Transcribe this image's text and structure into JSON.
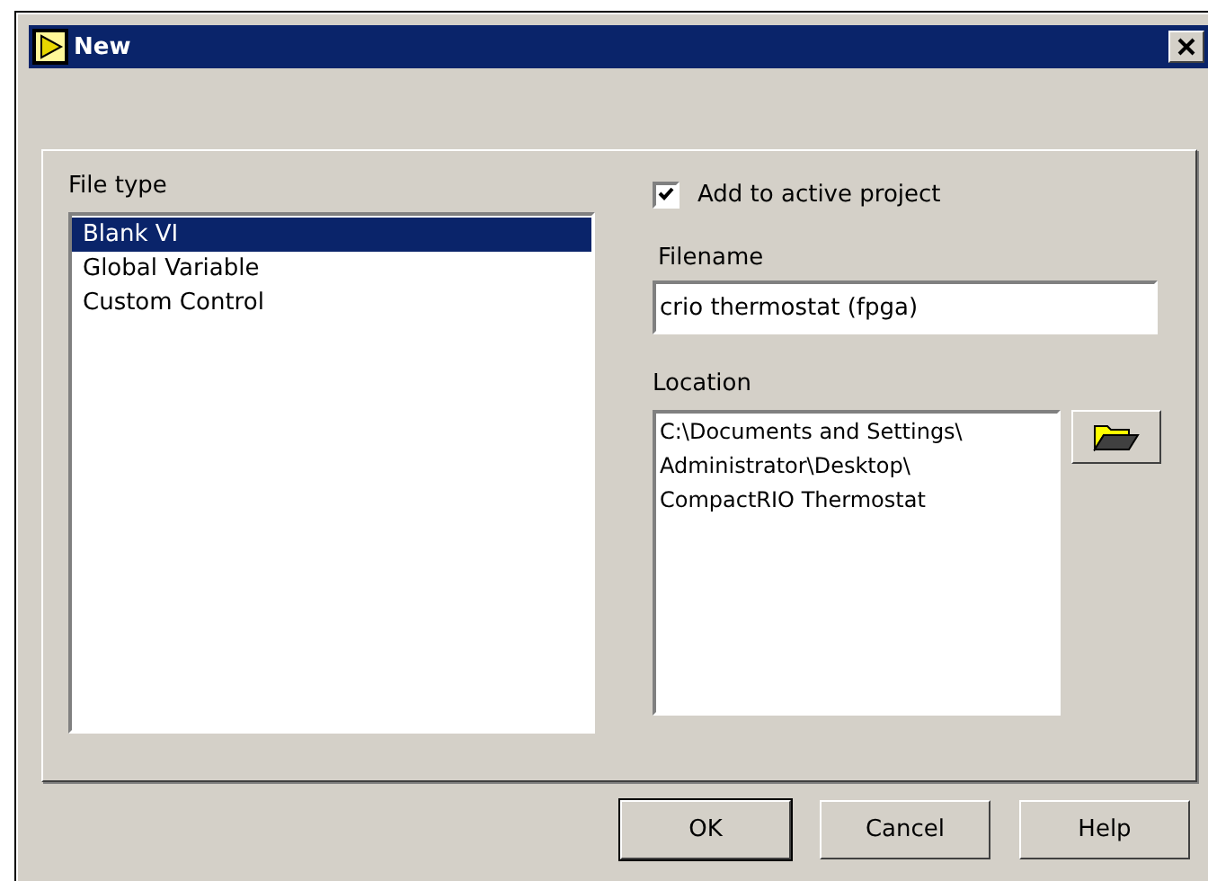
{
  "window": {
    "title": "New"
  },
  "file_type": {
    "label": "File type",
    "items": [
      {
        "label": "Blank VI",
        "selected": true
      },
      {
        "label": "Global Variable",
        "selected": false
      },
      {
        "label": "Custom Control",
        "selected": false
      }
    ]
  },
  "add_to_project": {
    "label": "Add to active project",
    "checked": true
  },
  "filename": {
    "label": "Filename",
    "value": "crio thermostat (fpga)"
  },
  "location": {
    "label": "Location",
    "value": "C:\\Documents and Settings\\\nAdministrator\\Desktop\\\nCompactRIO Thermostat"
  },
  "buttons": [
    {
      "label": "OK",
      "default": true
    },
    {
      "label": "Cancel",
      "default": false
    },
    {
      "label": "Help",
      "default": false
    }
  ]
}
